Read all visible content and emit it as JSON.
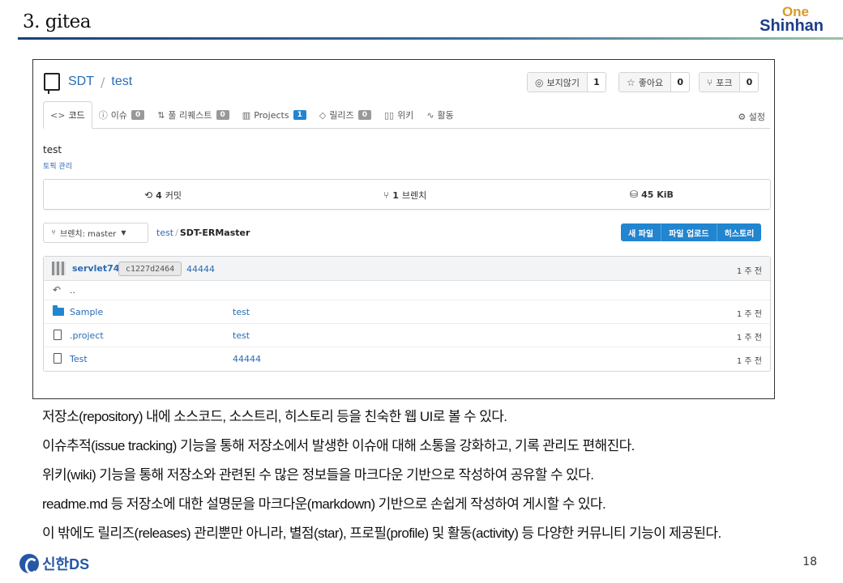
{
  "slide": {
    "title": "3. gitea",
    "logo_one": "One",
    "logo_shinhan": "Shinhan",
    "footer_logo": "신한DS",
    "page_number": "18"
  },
  "repo": {
    "owner": "SDT",
    "separator": "/",
    "name": "test",
    "watch": {
      "label": "보지않기",
      "count": "1"
    },
    "star": {
      "label": "좋아요",
      "count": "0"
    },
    "fork": {
      "label": "포크",
      "count": "0"
    }
  },
  "tabs": [
    {
      "label": "코드",
      "icon": "code-icon",
      "active": true
    },
    {
      "label": "이슈",
      "badge": "0",
      "icon": "issue-icon"
    },
    {
      "label": "풀 리퀘스트",
      "badge": "0",
      "icon": "pull-request-icon"
    },
    {
      "label": "Projects",
      "badge": "1",
      "icon": "project-icon"
    },
    {
      "label": "릴리즈",
      "badge": "0",
      "icon": "tag-icon"
    },
    {
      "label": "위키",
      "icon": "book-icon"
    },
    {
      "label": "활동",
      "icon": "pulse-icon"
    }
  ],
  "settings_label": "설정",
  "description": "test",
  "topic_link": "토픽 관리",
  "stats": {
    "commits_count": "4",
    "commits_label": "커밋",
    "branches_count": "1",
    "branches_label": "브렌치",
    "size": "45 KiB"
  },
  "branch_selector": "브렌치: master",
  "path": {
    "root": "test",
    "sep": "/",
    "current": "SDT-ERMaster"
  },
  "actions": {
    "new_file": "새 파일",
    "upload": "파일 업로드",
    "history": "히스토리"
  },
  "latest_commit": {
    "author": "servlet74",
    "sha": "c1227d2464",
    "message": "44444",
    "age": "1 주 전"
  },
  "parent_dir": "..",
  "files": [
    {
      "name": "Sample",
      "type": "folder",
      "message": "test",
      "age": "1 주 전"
    },
    {
      "name": ".project",
      "type": "file",
      "message": "test",
      "age": "1 주 전"
    },
    {
      "name": "Test",
      "type": "file",
      "message": "44444",
      "age": "1 주 전"
    }
  ],
  "bullets": [
    "저장소(repository) 내에 소스코드, 소스트리, 히스토리 등을 친숙한 웹 UI로 볼 수 있다.",
    "이슈추적(issue tracking) 기능을 통해 저장소에서 발생한 이슈애 대해 소통을 강화하고, 기록 관리도 편해진다.",
    "위키(wiki) 기능을 통해 저장소와 관련된 수 많은 정보들을 마크다운 기반으로 작성하여 공유할 수 있다.",
    "readme.md 등 저장소에 대한 설명문을 마크다운(markdown) 기반으로 손쉽게 작성하여 게시할 수 있다.",
    "이 밖에도 릴리즈(releases) 관리뿐만 아니라, 별점(star), 프로필(profile) 및 활동(activity) 등 다양한 커뮤니티 기능이 제공된다."
  ]
}
